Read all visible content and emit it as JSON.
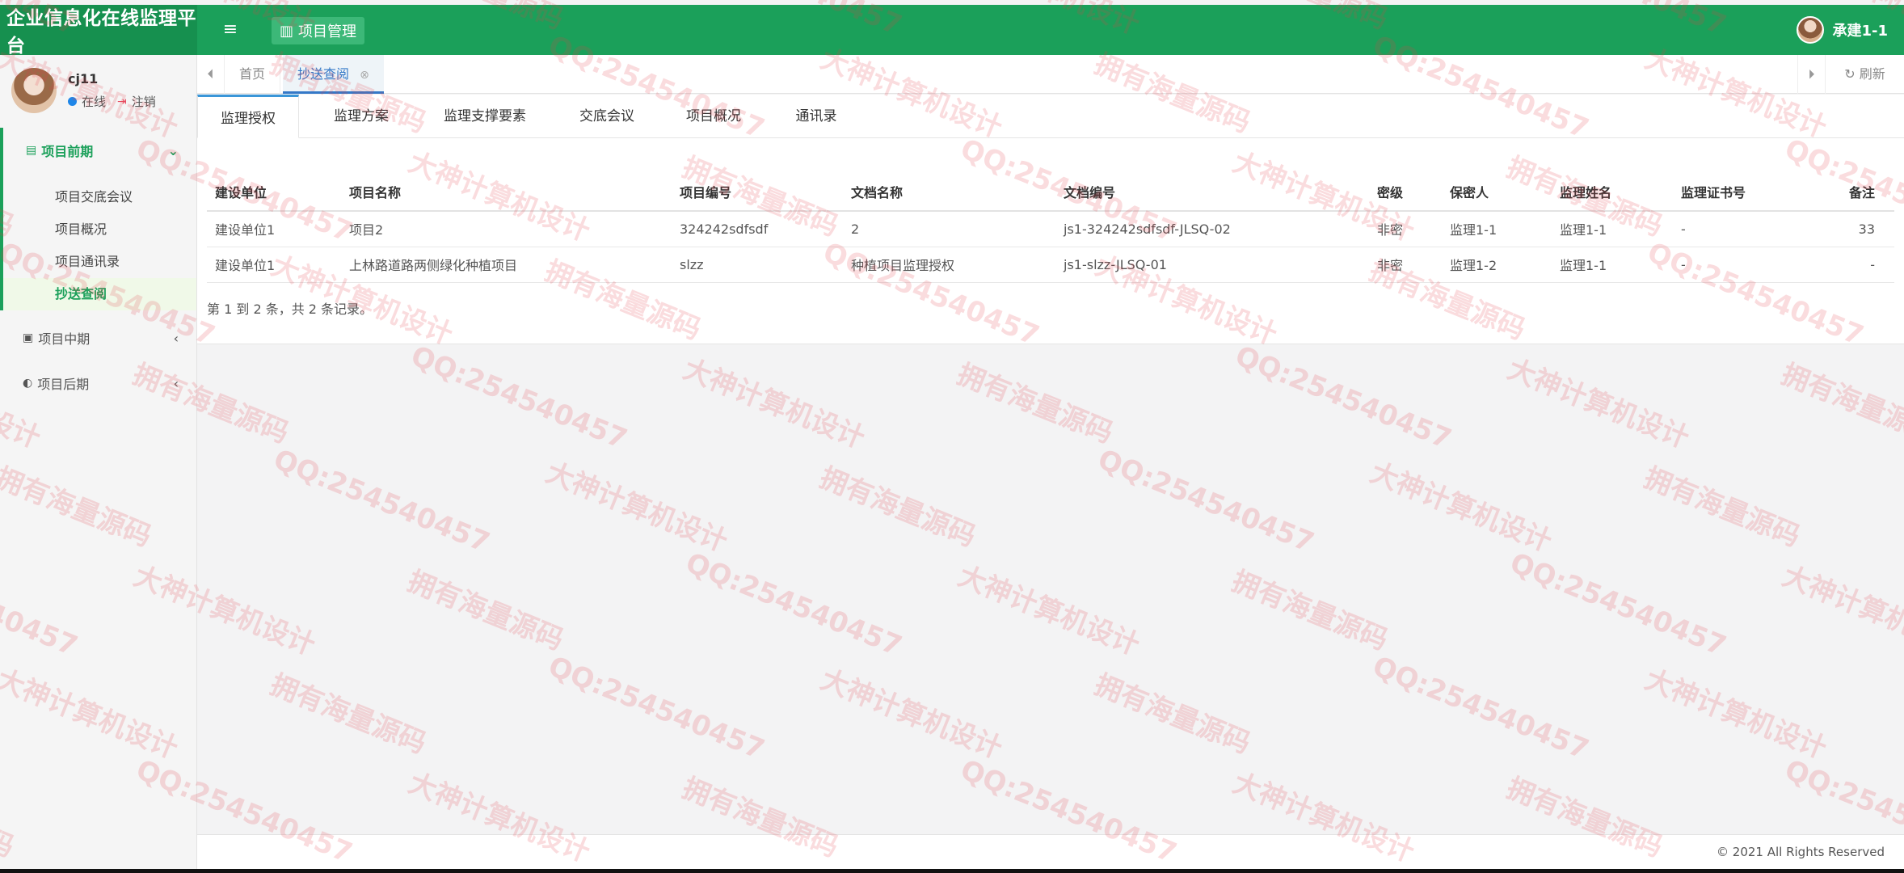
{
  "app": {
    "title": "企业信息化在线监理平台",
    "top_nav_label": "项目管理",
    "user_name": "承建1-1"
  },
  "profile": {
    "name": "cj11",
    "status": "在线",
    "logout": "注销"
  },
  "sidebar": {
    "groups": [
      {
        "label": "项目前期",
        "expanded": true,
        "children": [
          "项目交底会议",
          "项目概况",
          "项目通讯录",
          "抄送查阅"
        ],
        "active_child": 3
      },
      {
        "label": "项目中期",
        "expanded": false
      },
      {
        "label": "项目后期",
        "expanded": false
      }
    ]
  },
  "tabs": {
    "home": "首页",
    "current": "抄送查阅",
    "refresh": "刷新"
  },
  "subtabs": [
    "监理授权",
    "监理方案",
    "监理支撑要素",
    "交底会议",
    "项目概况",
    "通讯录"
  ],
  "table": {
    "headers": [
      "建设单位",
      "项目名称",
      "项目编号",
      "文档名称",
      "文档编号",
      "密级",
      "保密人",
      "监理姓名",
      "监理证书号",
      "备注"
    ],
    "rows": [
      [
        "建设单位1",
        "项目2",
        "324242sdfsdf",
        "2",
        "js1-324242sdfsdf-JLSQ-02",
        "非密",
        "监理1-1",
        "监理1-1",
        "-",
        "33"
      ],
      [
        "建设单位1",
        "上林路道路两侧绿化种植项目",
        "slzz",
        "种植项目监理授权",
        "js1-slzz-JLSQ-01",
        "非密",
        "监理1-2",
        "监理1-1",
        "-",
        "-"
      ]
    ]
  },
  "pager": "第 1 到 2 条，共 2 条记录。",
  "footer": "© 2021 All Rights Reserved",
  "watermark": {
    "texts": [
      "QQ:254540457",
      "大神计算机设计",
      "拥有海量源码"
    ]
  },
  "colors": {
    "header_green": "#1ba05a",
    "active_green": "#1ba05a",
    "tab_blue": "#3478c7",
    "watermark": "#e63c46"
  }
}
